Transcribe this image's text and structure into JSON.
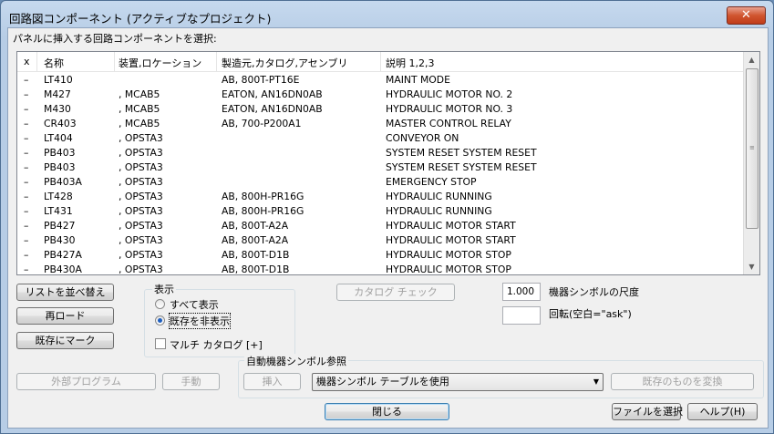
{
  "window": {
    "title": "回路図コンポーネント (アクティブなプロジェクト)",
    "close_glyph": "✕"
  },
  "instruction": "パネルに挿入する回路コンポーネントを選択:",
  "table": {
    "columns": [
      "x",
      "名称",
      "装置,ロケーション",
      "製造元,カタログ,アセンブリ",
      "説明 1,2,3"
    ],
    "rows": [
      [
        "–",
        "LT410",
        "",
        "AB, 800T-PT16E",
        "MAINT MODE"
      ],
      [
        "–",
        "M427",
        ", MCAB5",
        "EATON, AN16DN0AB",
        "HYDRAULIC MOTOR NO. 2"
      ],
      [
        "–",
        "M430",
        ", MCAB5",
        "EATON, AN16DN0AB",
        "HYDRAULIC MOTOR NO. 3"
      ],
      [
        "–",
        "CR403",
        ", MCAB5",
        "AB, 700-P200A1",
        "MASTER CONTROL RELAY"
      ],
      [
        "–",
        "LT404",
        ", OPSTA3",
        "",
        "CONVEYOR ON"
      ],
      [
        "–",
        "PB403",
        ", OPSTA3",
        "",
        "SYSTEM RESET SYSTEM RESET"
      ],
      [
        "–",
        "PB403",
        ", OPSTA3",
        "",
        "SYSTEM RESET SYSTEM RESET"
      ],
      [
        "–",
        "PB403A",
        ", OPSTA3",
        "",
        "EMERGENCY STOP"
      ],
      [
        "–",
        "LT428",
        ", OPSTA3",
        "AB, 800H-PR16G",
        "HYDRAULIC RUNNING"
      ],
      [
        "–",
        "LT431",
        ", OPSTA3",
        "AB, 800H-PR16G",
        "HYDRAULIC RUNNING"
      ],
      [
        "–",
        "PB427",
        ", OPSTA3",
        "AB, 800T-A2A",
        "HYDRAULIC MOTOR START"
      ],
      [
        "–",
        "PB430",
        ", OPSTA3",
        "AB, 800T-A2A",
        "HYDRAULIC MOTOR START"
      ],
      [
        "–",
        "PB427A",
        ", OPSTA3",
        "AB, 800T-D1B",
        "HYDRAULIC MOTOR STOP"
      ],
      [
        "–",
        "PB430A",
        ", OPSTA3",
        "AB, 800T-D1B",
        "HYDRAULIC MOTOR STOP"
      ]
    ]
  },
  "buttons": {
    "sort": "リストを並べ替え",
    "reload": "再ロード",
    "mark_existing": "既存にマーク",
    "catalog_check": "カタログ チェック",
    "external_program": "外部プログラム",
    "manual": "手動",
    "insert": "挿入",
    "convert_existing": "既存のものを変換",
    "close": "閉じる",
    "select_file": "ファイルを選択",
    "help": "ヘルプ(H)"
  },
  "display_group": {
    "label": "表示",
    "show_all": "すべて表示",
    "hide_existing": "既存を非表示",
    "selected": "hide_existing",
    "multi_catalog": "マルチ カタログ [+]",
    "multi_catalog_checked": false
  },
  "scale": {
    "value": "1.000",
    "label": "機器シンボルの尺度"
  },
  "rotation": {
    "value": "",
    "label": "回転(空白=\"ask\")"
  },
  "auto_ref": {
    "label": "自動機器シンボル参照",
    "combo_value": "機器シンボル テーブルを使用"
  },
  "icons": {
    "scroll_up": "▲",
    "scroll_down": "▼",
    "dropdown": "▼"
  }
}
